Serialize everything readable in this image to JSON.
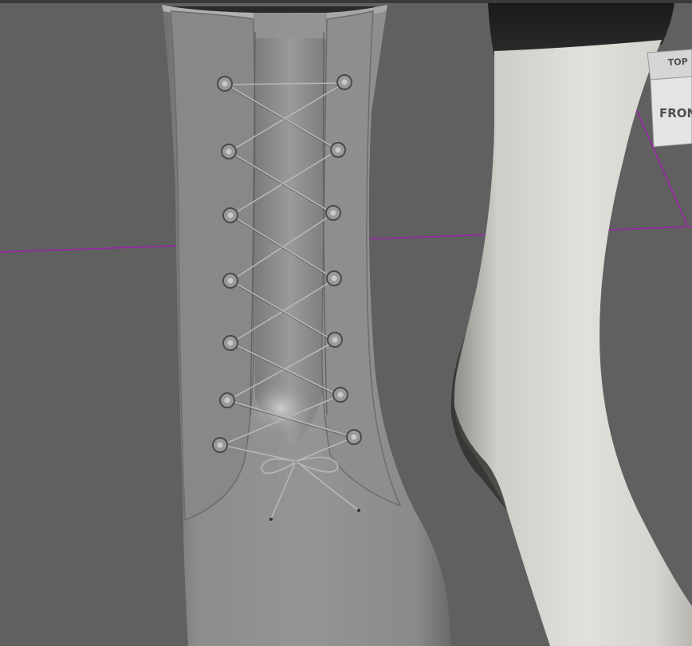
{
  "viewport": {
    "name": "3d-viewport",
    "background": "#606060",
    "grid_line_color": "#a020b0"
  },
  "view_cube": {
    "top_face_label": "TOP",
    "front_face_label": "FRONT"
  },
  "scene": {
    "boot": {
      "color": "#8a8a8a",
      "eyelet_pairs": 7
    },
    "leg": {
      "color": "#d8d6d0"
    }
  }
}
